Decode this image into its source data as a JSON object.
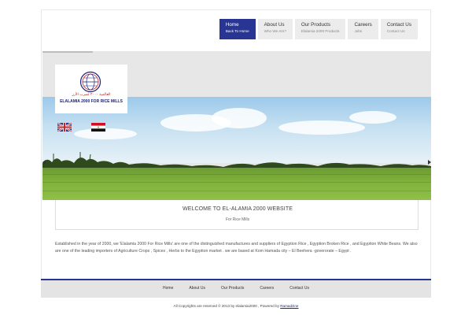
{
  "nav": [
    {
      "title": "Home",
      "sub": "Back To Home",
      "active": true
    },
    {
      "title": "About Us",
      "sub": "Who We Are?",
      "active": false
    },
    {
      "title": "Our Products",
      "sub": "Elalamia 2000 Products",
      "active": false
    },
    {
      "title": "Careers",
      "sub": "Jobs",
      "active": false
    },
    {
      "title": "Contact Us",
      "sub": "Contact Us",
      "active": false
    }
  ],
  "logo": {
    "arabic": "العالمية ٢٠٠٠ لضرب الأرز",
    "english": "ELALAMIA 2000 FOR RICE MILLS"
  },
  "welcome": {
    "title": "WELCOME TO EL-ALAMIA 2000 WEBSITE",
    "subtitle": "For Rice Mills"
  },
  "intro": "Established in the year of 2000, we 'Elalamia 2000 For Rice Mills' are one of the distinguished manufactures and suppliers of Egyption Rice , Egyption Broken Rice , and Egyption White Beans. We also are one of the leading importers of Agriculture Crops , Spices , Herbs to the Egyption market . we are based at Kom Hamada city – El Beehera -goverorate – Egypt .",
  "footer_nav": [
    "Home",
    "About Us",
    "Our Products",
    "Careers",
    "Contact Us"
  ],
  "copyright": {
    "text": "All Copyrights are reserved © 2013 by elalamia2000 , Powered by",
    "link": "Ramadzine"
  },
  "colors": {
    "accent": "#283593",
    "field": "#7fb03c"
  }
}
